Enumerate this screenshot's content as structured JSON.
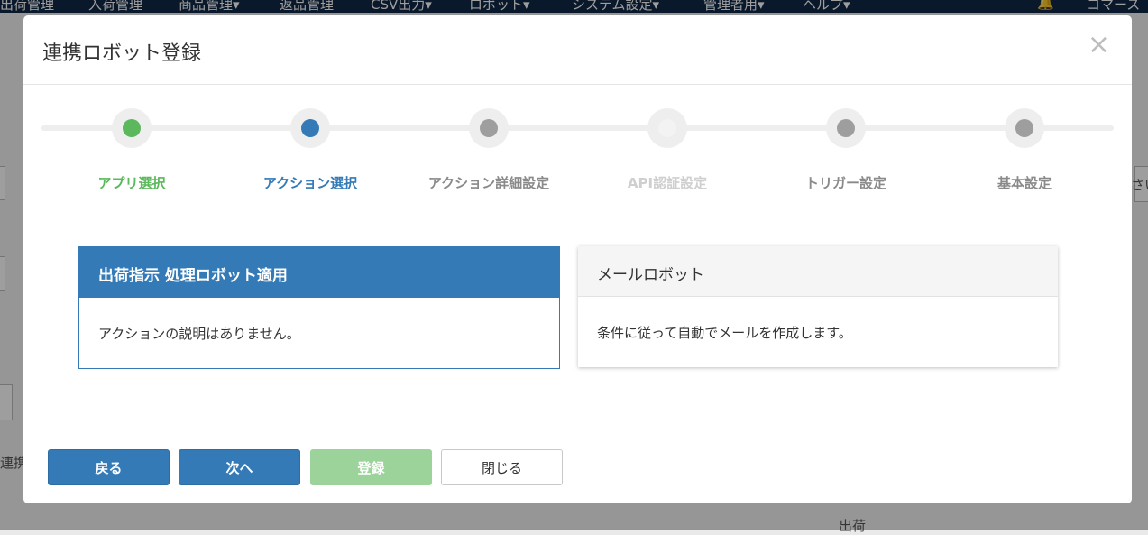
{
  "background": {
    "nav": [
      "出荷管理",
      "入荷管理",
      "商品管理▾",
      "返品管理",
      "CSV出力▾",
      "ロボット▾",
      "システム設定▾",
      "管理者用▾",
      "ヘルプ▾",
      "コマース"
    ],
    "fragments": [
      "連携",
      "さい",
      "出荷"
    ]
  },
  "modal": {
    "title": "連携ロボット登録",
    "close": "×"
  },
  "steps": [
    {
      "label": "アプリ選択",
      "state": "done",
      "dot_color": "#5cb85c",
      "label_color": "#5cb85c"
    },
    {
      "label": "アクション選択",
      "state": "current",
      "dot_color": "#337ab7",
      "label_color": "#337ab7"
    },
    {
      "label": "アクション詳細設定",
      "state": "todo",
      "dot_color": "#9e9e9e",
      "label_color": "#8a8a8a"
    },
    {
      "label": "API認証設定",
      "state": "disabled",
      "dot_color": "#f3f3f3",
      "label_color": "#cfcfcf"
    },
    {
      "label": "トリガー設定",
      "state": "todo",
      "dot_color": "#9e9e9e",
      "label_color": "#8a8a8a"
    },
    {
      "label": "基本設定",
      "state": "todo",
      "dot_color": "#9e9e9e",
      "label_color": "#8a8a8a"
    }
  ],
  "actions": [
    {
      "title": "出荷指示 処理ロボット適用",
      "description": "アクションの説明はありません。",
      "selected": true
    },
    {
      "title": "メールロボット",
      "description": "条件に従って自動でメールを作成します。",
      "selected": false
    }
  ],
  "footer": {
    "back": "戻る",
    "next": "次へ",
    "register": "登録",
    "close": "閉じる"
  }
}
